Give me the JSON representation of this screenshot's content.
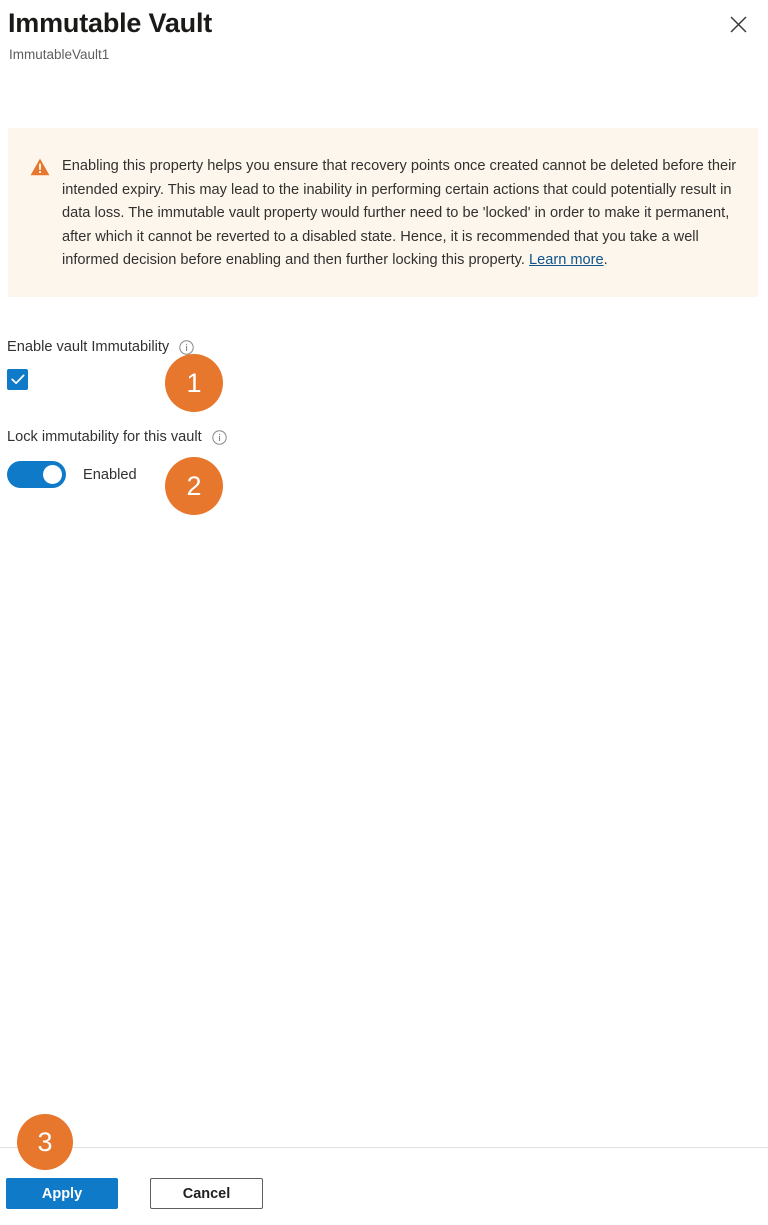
{
  "header": {
    "title": "Immutable Vault",
    "subtitle": "ImmutableVault1",
    "close_icon": "close-icon"
  },
  "banner": {
    "icon": "warning-triangle-icon",
    "text_before_link": "Enabling this property helps you ensure that recovery points once created cannot be deleted before their intended expiry. This may lead to the inability in performing certain actions that could potentially result in data loss. The immutable vault property would further need to be 'locked' in order to make it permanent, after which it cannot be reverted to a disabled state. Hence, it is recommended that you take a well informed decision before enabling and then further locking this property. ",
    "link_label": "Learn more",
    "text_after_link": ".",
    "background_color": "#FDF6EC",
    "icon_color": "#E8772E"
  },
  "fields": {
    "immutability": {
      "label": "Enable vault Immutability",
      "info_icon": "info-icon",
      "checkbox_checked": true
    },
    "lock": {
      "label": "Lock immutability for this vault",
      "info_icon": "info-icon",
      "toggle_state_label": "Enabled",
      "toggle_on": true
    }
  },
  "footer": {
    "apply_label": "Apply",
    "cancel_label": "Cancel",
    "accent_color": "#0F7AC8"
  },
  "annotations": {
    "badge_color": "#E8772E",
    "items": [
      {
        "number": "1"
      },
      {
        "number": "2"
      },
      {
        "number": "3"
      }
    ]
  }
}
